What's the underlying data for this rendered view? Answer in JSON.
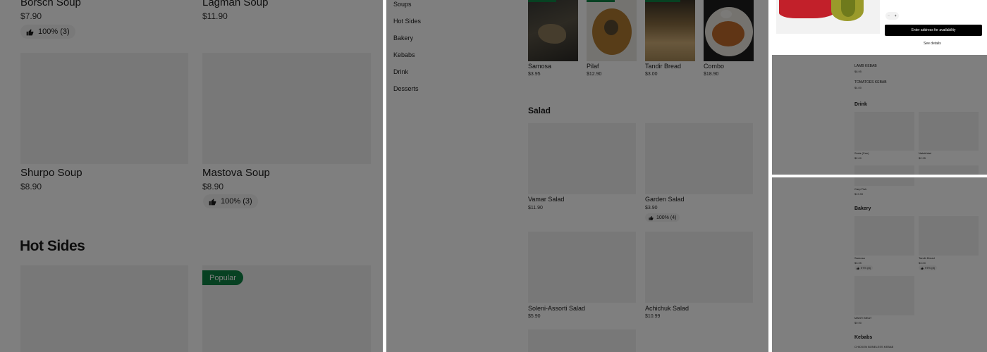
{
  "panel1": {
    "row1": [
      {
        "name": "Borsch Soup",
        "price": "$7.90",
        "rating": "100% (3)"
      },
      {
        "name": "Lagman Soup",
        "price": "$11.90"
      }
    ],
    "row2": [
      {
        "name": "Shurpo Soup",
        "price": "$8.90"
      },
      {
        "name": "Mastova Soup",
        "price": "$8.90",
        "rating": "100% (3)"
      }
    ],
    "section_title": "Hot Sides",
    "popular_badge": "Popular"
  },
  "panel2": {
    "categories": [
      "Soups",
      "Hot Sides",
      "Bakery",
      "Kebabs",
      "Drink",
      "Desserts"
    ],
    "top_items": [
      {
        "name": "Samosa",
        "price": "$3.95"
      },
      {
        "name": "Pilaf",
        "price": "$12.90"
      },
      {
        "name": "Tandir Bread",
        "price": "$3.00"
      },
      {
        "name": "Combo",
        "price": "$18.90"
      }
    ],
    "salad_title": "Salad",
    "salads": [
      {
        "name": "Vamar Salad",
        "price": "$11.90"
      },
      {
        "name": "Garden Salad",
        "price": "$3.90",
        "rating": "100% (4)"
      },
      {
        "name": "Soleni-Assorti Salad",
        "price": "$5.90"
      },
      {
        "name": "Achichuk Salad",
        "price": "$10.99"
      }
    ]
  },
  "panel3": {
    "address_button": "Enter address for availability",
    "see_details": "See details",
    "qty_minus": "−",
    "qty_plus": "+",
    "kebab_items": [
      {
        "name": "LAMB KEBAB",
        "price": "$8.95"
      },
      {
        "name": "TOMATOES KEBAB",
        "price": "$4.00"
      }
    ],
    "drink_title": "Drink",
    "drinks": [
      {
        "name": "Soda (Can)",
        "price": "$2.00"
      },
      {
        "name": "Natakhtari",
        "price": "$2.95"
      }
    ]
  },
  "panel4": {
    "top_item": {
      "name": "Carp Fish",
      "price": "$19.90"
    },
    "bakery_title": "Bakery",
    "bakery": [
      {
        "name": "Samosa",
        "price": "$3.95",
        "rating": "97% (8)"
      },
      {
        "name": "Tandir Bread",
        "price": "$3.00",
        "rating": "97% (8)"
      },
      {
        "name": "MANTI MEAT",
        "price": "$9.90"
      }
    ],
    "kebabs_title": "Kebabs",
    "kebab_first": "CHICKEN BONELESS KEBAB"
  },
  "colors": {
    "popular_green": "#0e8345",
    "overlay": "rgba(0,0,0,0.5)",
    "button_black": "#000000"
  }
}
